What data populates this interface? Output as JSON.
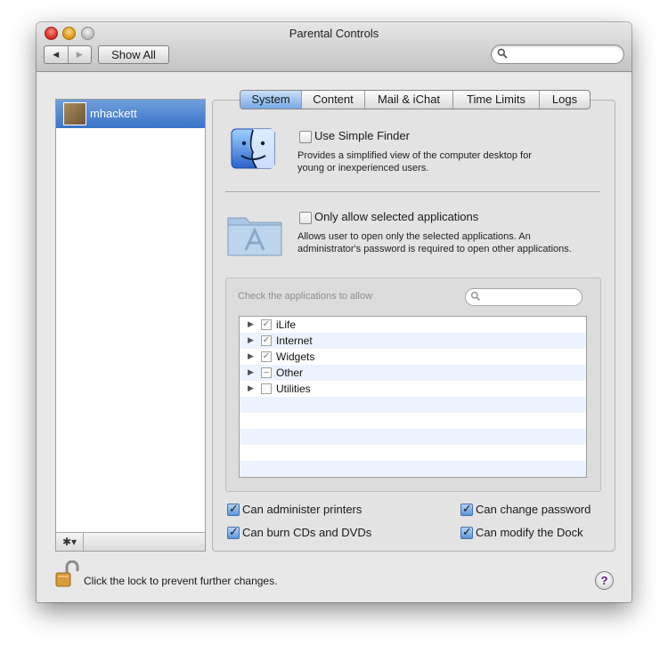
{
  "window": {
    "title": "Parental Controls",
    "back_glyph": "◀",
    "forward_glyph": "▶",
    "show_all_label": "Show All",
    "search_value": ""
  },
  "users": [
    {
      "name": "mhackett",
      "selected": true
    }
  ],
  "user_list_footer": {
    "gear_glyph": "✱▾"
  },
  "tabs": [
    {
      "label": "System",
      "active": true
    },
    {
      "label": "Content",
      "active": false
    },
    {
      "label": "Mail & iChat",
      "active": false
    },
    {
      "label": "Time Limits",
      "active": false
    },
    {
      "label": "Logs",
      "active": false
    }
  ],
  "system": {
    "simple_finder": {
      "label": "Use Simple Finder",
      "checked": false,
      "description_line1": "Provides a simplified view of the computer desktop for",
      "description_line2": "young or inexperienced users."
    },
    "only_selected_apps": {
      "label": "Only allow selected applications",
      "checked": false,
      "description_line1": "Allows user to open only the selected applications. An",
      "description_line2": "administrator's password is required to open other applications."
    },
    "apps_box": {
      "title": "Check the applications to allow",
      "search_value": "",
      "apps": [
        {
          "name": "iLife",
          "state": "checked"
        },
        {
          "name": "Internet",
          "state": "checked"
        },
        {
          "name": "Widgets",
          "state": "checked"
        },
        {
          "name": "Other",
          "state": "mixed"
        },
        {
          "name": "Utilities",
          "state": "unchecked"
        }
      ]
    },
    "options": [
      {
        "label": "Can administer printers",
        "checked": true
      },
      {
        "label": "Can change password",
        "checked": true
      },
      {
        "label": "Can burn CDs and DVDs",
        "checked": true
      },
      {
        "label": "Can modify the Dock",
        "checked": true
      }
    ]
  },
  "footer": {
    "lock_text": "Click the lock to prevent further changes.",
    "help_glyph": "?"
  },
  "colors": {
    "selection_blue": "#3a73c8",
    "tab_active": "#78aae6",
    "help_purple": "#5a1a9a"
  }
}
